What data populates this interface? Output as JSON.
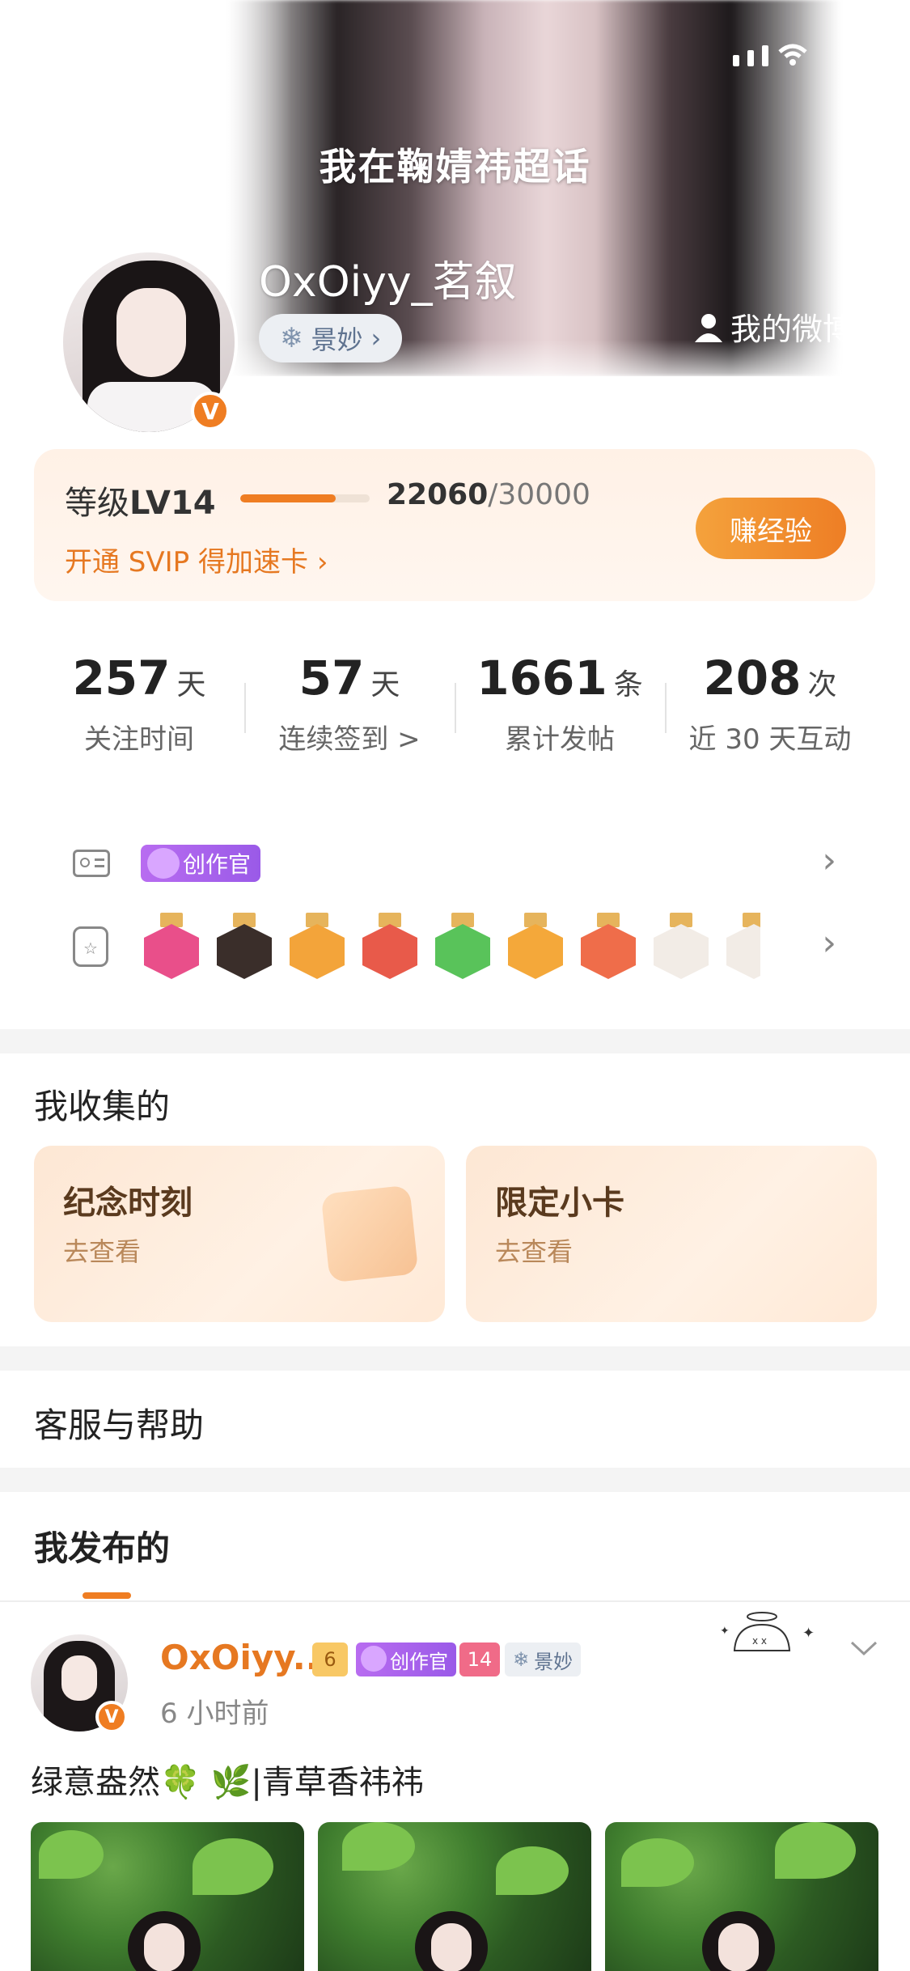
{
  "header": {
    "title": "我在鞠婧祎超话",
    "username": "OxOiyy_茗叙",
    "tag_label": "景妙",
    "my_weibo": "我的微博",
    "verified_badge": "V"
  },
  "level": {
    "label_prefix": "等级",
    "level": "LV14",
    "current": "22060",
    "total": "/30000",
    "progress": 0.7353,
    "svip_text": "开通 SVIP 得加速卡",
    "earn_button": "赚经验"
  },
  "stats": [
    {
      "value": "257",
      "unit": "天",
      "label": "关注时间"
    },
    {
      "value": "57",
      "unit": "天",
      "label": "连续签到 >"
    },
    {
      "value": "1661",
      "unit": "条",
      "label": "累计发帖"
    },
    {
      "value": "208",
      "unit": "次",
      "label": "近 30 天互动"
    }
  ],
  "badges": {
    "creator_tag": "创作官",
    "medals": [
      "LV14",
      "SUPER",
      "crown",
      "cat",
      "hand",
      "30",
      "rock",
      "girl-1",
      "girl-2"
    ]
  },
  "collections": {
    "title": "我收集的",
    "items": [
      {
        "title": "纪念时刻",
        "sub": "去查看"
      },
      {
        "title": "限定小卡",
        "sub": "去查看"
      }
    ]
  },
  "help": {
    "title": "客服与帮助"
  },
  "posts": {
    "tab_title": "我发布的",
    "author": "OxOiyy...",
    "time": "6 小时前",
    "text": "绿意盎然🍀 🌿|青草香祎祎",
    "tags": {
      "crown_num": "6",
      "creator": "创作官",
      "gem_num": "14",
      "jm": "景妙"
    }
  },
  "colors": {
    "accent": "#ef7d22",
    "creator": "#a862ee",
    "tag_text": "#5f7390"
  }
}
